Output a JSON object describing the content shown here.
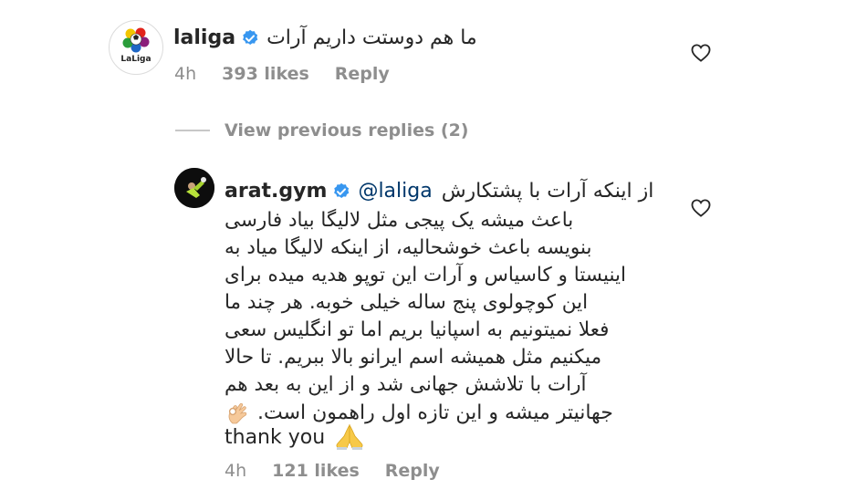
{
  "comment": {
    "username": "laliga",
    "text": "ما هم دوستت داریم آرات",
    "time": "4h",
    "likes": "393 likes",
    "reply": "Reply",
    "avatar_text": "LaLiga"
  },
  "view_replies": "View previous replies (2)",
  "reply_comment": {
    "username": "arat.gym",
    "mention": "@laliga",
    "first_line": "از اینکه آرات با پشتکارش",
    "lines": [
      "باعث میشه یک پیجی مثل لالیگا بیاد فارسی",
      "بنویسه  باعث خوشحالیه، از اینکه  لالیگا میاد به",
      "اینیستا و کاسیاس و آرات این توپو هدیه میده برای",
      "این کوچولوی پنج ساله خیلی خوبه. هر چند ما",
      "فعلا نمیتونیم به اسپانیا بریم اما تو انگلیس سعی",
      "میکنیم مثل همیشه اسم ایرانو بالا ببریم. تا حالا",
      "آرات با تلاشش جهانی شد و از این به بعد هم",
      "جهانیتر میشه و این تازه اول راهمون است."
    ],
    "last_line": "thank you",
    "time": "4h",
    "likes": "121 likes",
    "reply": "Reply"
  },
  "colors": {
    "text": "#262626",
    "muted": "#8e8e8e",
    "verified": "#3897f0",
    "mention": "#00376b"
  },
  "icons": [
    "laliga-logo",
    "verified-badge-icon",
    "heart-icon",
    "ok-hand-emoji-icon",
    "folded-hands-emoji-icon"
  ]
}
